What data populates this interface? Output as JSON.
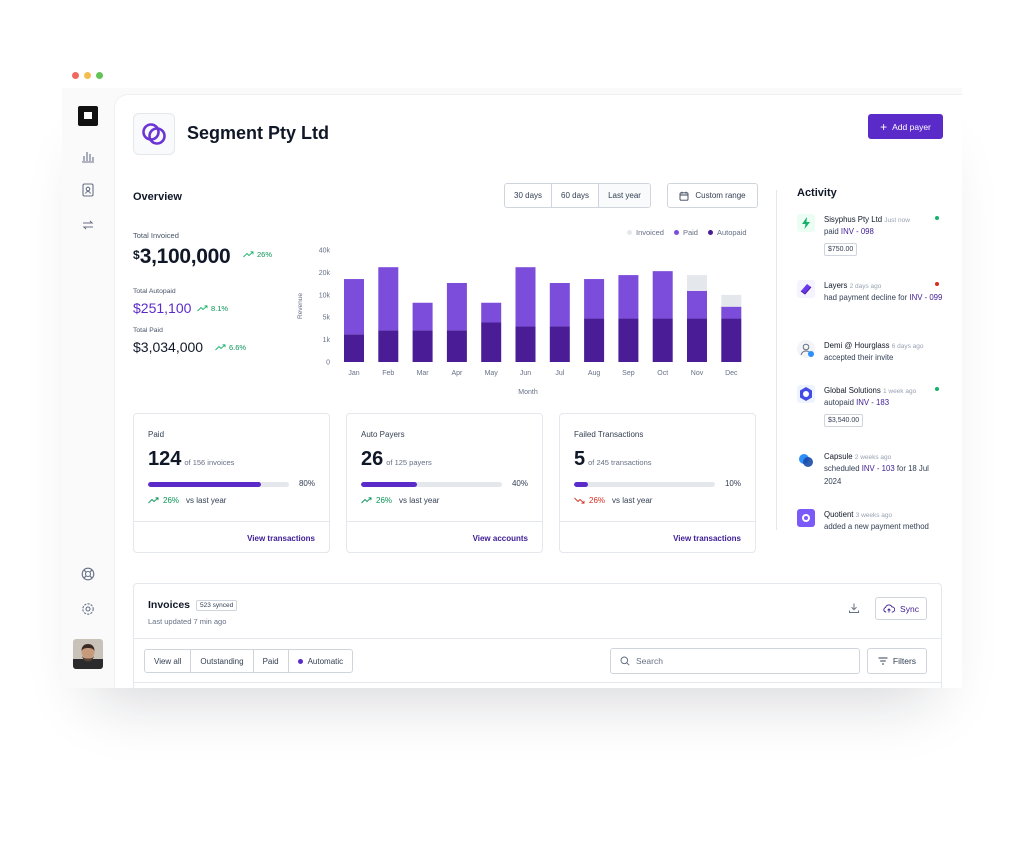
{
  "window_dots": [
    "#ee6a5f",
    "#f5bd4f",
    "#61c454"
  ],
  "sidebar": {
    "icons": [
      "logo-icon",
      "bar-chart-icon",
      "contact-icon",
      "repeat-icon",
      "help-icon",
      "settings-icon"
    ],
    "avatar": "user-avatar"
  },
  "header": {
    "company": "Segment Pty Ltd",
    "add_button": "Add payer"
  },
  "overview": {
    "title": "Overview",
    "ranges": [
      "30 days",
      "60 days",
      "Last year"
    ],
    "custom_range": "Custom range",
    "total_invoiced_label": "Total Invoiced",
    "total_invoiced_currency": "$",
    "total_invoiced_value": "3,100,000",
    "total_invoiced_trend": "26%",
    "total_autopaid_label": "Total Autopaid",
    "total_autopaid_value": "$251,100",
    "total_autopaid_trend": "8.1%",
    "total_paid_label": "Total Paid",
    "total_paid_value": "$3,034,000",
    "total_paid_trend": "6.6%"
  },
  "chart_data": {
    "type": "bar",
    "categories": [
      "Jan",
      "Feb",
      "Mar",
      "Apr",
      "May",
      "Jun",
      "Jul",
      "Aug",
      "Sep",
      "Oct",
      "Nov",
      "Dec"
    ],
    "series": [
      {
        "name": "Invoiced",
        "color": "#e4e7ec",
        "values": [
          0,
          0,
          0,
          0,
          0,
          0,
          0,
          0,
          0,
          0,
          4,
          3
        ]
      },
      {
        "name": "Paid",
        "color": "#7c4ddb",
        "values": [
          14,
          16,
          7,
          12,
          5,
          15,
          11,
          10,
          11,
          12,
          7,
          3
        ]
      },
      {
        "name": "Autopaid",
        "color": "#4a1d96",
        "values": [
          7,
          8,
          8,
          8,
          10,
          9,
          9,
          11,
          11,
          11,
          11,
          11
        ]
      }
    ],
    "stacked": true,
    "xlabel": "Month",
    "ylabel": "Revenue",
    "ytick_labels": [
      "0",
      "1k",
      "5k",
      "10k",
      "20k",
      "40k"
    ],
    "legend": "top-right"
  },
  "cards": [
    {
      "title": "Paid",
      "value": "124",
      "sub": "of 156 invoices",
      "pct_label": "80%",
      "fill": 0.8,
      "trend": "26%",
      "trend_dir": "up",
      "vs": "vs last year",
      "link": "View transactions"
    },
    {
      "title": "Auto Payers",
      "value": "26",
      "sub": "of 125 payers",
      "pct_label": "40%",
      "fill": 0.4,
      "trend": "26%",
      "trend_dir": "up",
      "vs": "vs last year",
      "link": "View accounts"
    },
    {
      "title": "Failed Transactions",
      "value": "5",
      "sub": "of 245 transactions",
      "pct_label": "10%",
      "fill": 0.1,
      "trend": "26%",
      "trend_dir": "down",
      "vs": "vs last year",
      "link": "View transactions"
    }
  ],
  "activity": {
    "title": "Activity",
    "items": [
      {
        "name": "Sisyphus Pty Ltd",
        "time": "Just now",
        "text": "paid",
        "invoice": "INV - 098",
        "tag": "$750.00",
        "dot": "#17b26a"
      },
      {
        "name": "Layers",
        "time": "2 days ago",
        "text": "had payment decline for",
        "invoice": "INV - 099",
        "tag": "",
        "dot": "#d92d20"
      },
      {
        "name": "Demi @ Hourglass",
        "time": "6 days ago",
        "text": "accepted their invite",
        "invoice": "",
        "tag": "",
        "dot": ""
      },
      {
        "name": "Global Solutions",
        "time": "1 week ago",
        "text": "autopaid",
        "invoice": "INV - 183",
        "tag": "$3,540.00",
        "dot": "#17b26a"
      },
      {
        "name": "Capsule",
        "time": "2 weeks ago",
        "text": "scheduled",
        "invoice": "INV - 103",
        "extra": "for 18 Jul 2024",
        "tag": "",
        "dot": ""
      },
      {
        "name": "Quotient",
        "time": "3 weeks ago",
        "text": "added a new payment method",
        "invoice": "",
        "tag": "",
        "dot": ""
      }
    ]
  },
  "invoices": {
    "title": "Invoices",
    "synced_badge": "523 synced",
    "last_updated": "Last updated 7 min ago",
    "sync_button": "Sync",
    "tabs": [
      "View all",
      "Outstanding",
      "Paid",
      "Automatic"
    ],
    "search_placeholder": "Search",
    "filters_button": "Filters"
  }
}
